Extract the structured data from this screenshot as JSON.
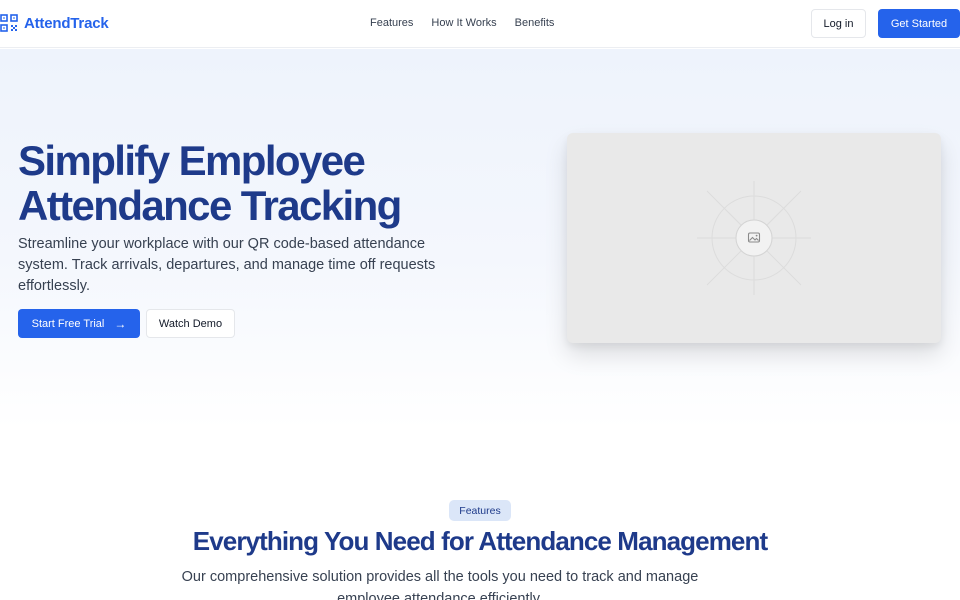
{
  "header": {
    "brand": "AttendTrack",
    "nav": [
      "Features",
      "How It Works",
      "Benefits"
    ],
    "login_label": "Log in",
    "get_started_label": "Get Started"
  },
  "hero": {
    "title_line1": "Simplify Employee",
    "title_line2": "Attendance Tracking",
    "subtitle": "Streamline your workplace with our QR code-based attendance system. Track arrivals, departures, and manage time off requests effortlessly.",
    "trial_label": "Start Free Trial",
    "trial_icon": "arrow-right-icon",
    "demo_label": "Watch Demo",
    "image_icon": "image-placeholder-icon"
  },
  "features": {
    "badge": "Features",
    "title": "Everything You Need for Attendance Management",
    "subtitle": "Our comprehensive solution provides all the tools you need to track and manage employee attendance efficiently."
  },
  "colors": {
    "brand": "#2563eb",
    "heading": "#1e3a8a",
    "hero_bg": "#eef3fc",
    "badge_bg": "#dbe6f8"
  }
}
